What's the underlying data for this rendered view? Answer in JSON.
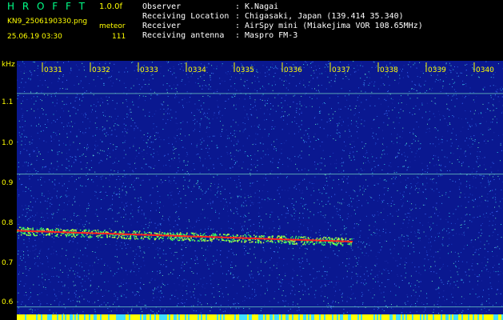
{
  "header": {
    "app_title": "H R O F F T",
    "version": "1.0.0f",
    "file_name": "KN9_2506190330.png",
    "object": "meteor",
    "timestamp": "25.06.19 03:30",
    "count": "111"
  },
  "info": {
    "rows": [
      {
        "key": "Observer",
        "value": "K.Nagai"
      },
      {
        "key": "Receiving Location",
        "value": "Chigasaki, Japan (139.414 35.340)"
      },
      {
        "key": "Receiver",
        "value": "AirSpy mini (Miakejima VOR 108.65MHz)"
      },
      {
        "key": "Receiving antenna",
        "value": "Maspro FM-3"
      }
    ],
    "separator": ":"
  },
  "axis": {
    "y_unit": "kHz",
    "y_ticks": [
      "1.1",
      "1.0",
      "0.9",
      "0.8",
      "0.7",
      "0.6"
    ],
    "y_tick_values": [
      1.1,
      1.0,
      0.9,
      0.8,
      0.7,
      0.6
    ],
    "x_ticks": [
      "0331",
      "0332",
      "0333",
      "0334",
      "0335",
      "0336",
      "0337",
      "0338",
      "0339",
      "0340"
    ]
  },
  "colors": {
    "background": "#000000",
    "noise_base": "#0a1890",
    "label_yellow": "#ffff00",
    "title_green": "#00ff88",
    "trail_red": "#ff2020",
    "trail_green": "#30ff60",
    "carrier_line": "#70d0c0"
  },
  "chart_data": {
    "type": "heatmap",
    "ylabel": "kHz",
    "ylim": [
      0.585,
      1.18
    ],
    "x_ticks": [
      "0331",
      "0332",
      "0333",
      "0334",
      "0335",
      "0336",
      "0337",
      "0338",
      "0339",
      "0340"
    ],
    "features": [
      {
        "kind": "meteor-trail",
        "start_minute": "0330",
        "end_minute": "0337",
        "start_khz": 0.79,
        "end_khz": 0.765
      },
      {
        "kind": "carrier-line",
        "khz": 1.105
      },
      {
        "kind": "carrier-line",
        "khz": 0.92
      },
      {
        "kind": "carrier-line",
        "khz": 0.615
      }
    ]
  }
}
